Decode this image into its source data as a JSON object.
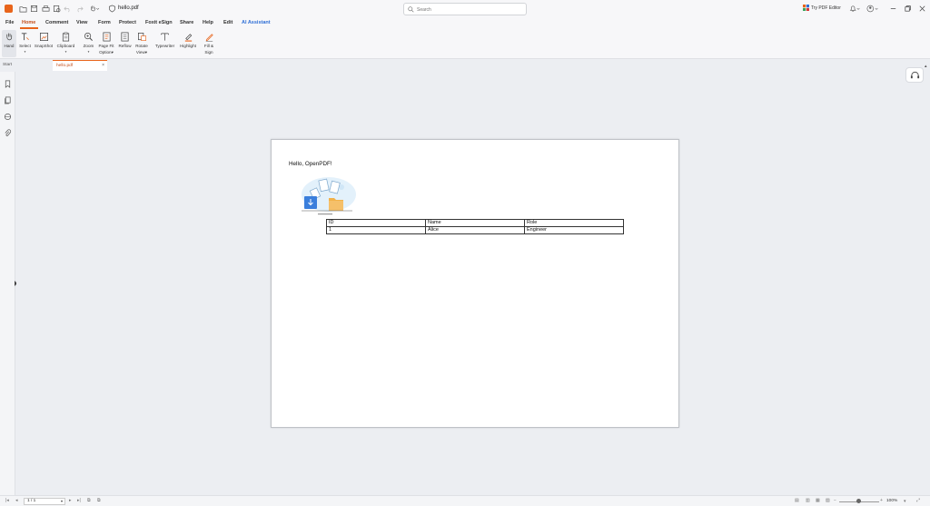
{
  "titlebar": {
    "doc_title": "hello.pdf",
    "search_placeholder": "Search",
    "try_editor": "Try PDF Editor"
  },
  "menu": {
    "items": [
      "File",
      "Home",
      "Comment",
      "View",
      "Form",
      "Protect",
      "Foxit eSign",
      "Share",
      "Help",
      "Edit",
      "AI Assistant"
    ],
    "active": "Home"
  },
  "ribbon": {
    "hand": "Hand",
    "select": "Select",
    "snapshot": "SnapShot",
    "clipboard": "Clipboard",
    "zoom": "Zoom",
    "page_fit_1": "Page Fit",
    "page_fit_2": "Option",
    "reflow": "Reflow",
    "rotate_1": "Rotate",
    "rotate_2": "View",
    "typewriter": "Typewriter",
    "highlight": "Highlight",
    "fill_sign_1": "Fill &",
    "fill_sign_2": "Sign"
  },
  "tabs": {
    "start": "Start",
    "doc": "hello.pdf",
    "close": "×"
  },
  "document": {
    "hello": "Hello, OpenPDF!",
    "table": {
      "header": [
        "ID",
        "Name",
        "Role"
      ],
      "rows": [
        [
          "1",
          "Alice",
          "Engineer"
        ]
      ]
    }
  },
  "status": {
    "page": "1 / 1",
    "zoom": "100%"
  },
  "colors": {
    "accent": "#e8641b",
    "ai_assistant": "#2f6fd6"
  }
}
